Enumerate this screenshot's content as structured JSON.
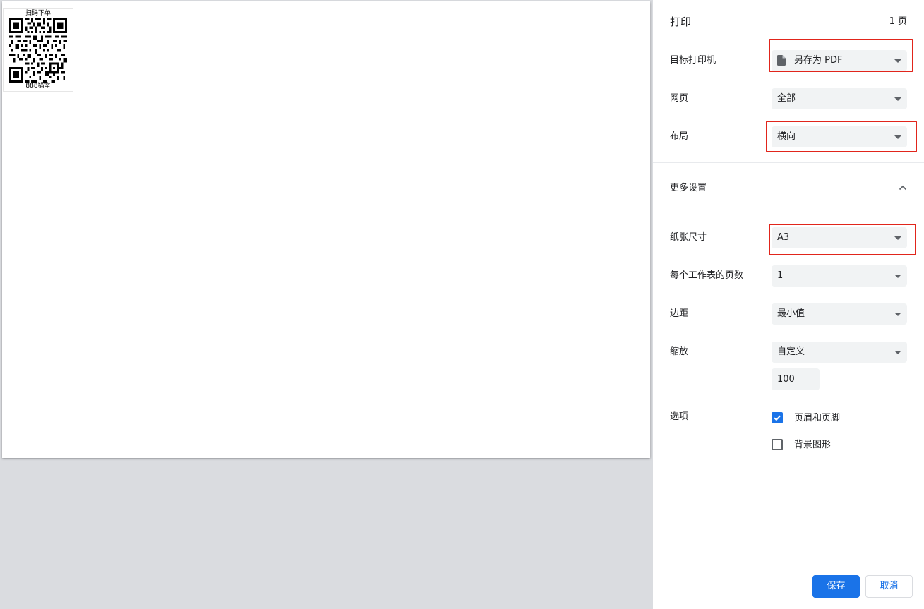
{
  "preview": {
    "label_top_text": "扫码下单",
    "label_bottom_text": "888猫室"
  },
  "header": {
    "title": "打印",
    "page_count": "1 页"
  },
  "settings": {
    "destination": {
      "label": "目标打印机",
      "value": "另存为 PDF",
      "icon": "document-icon"
    },
    "pages": {
      "label": "网页",
      "value": "全部"
    },
    "layout": {
      "label": "布局",
      "value": "横向"
    },
    "more_settings": {
      "label": "更多设置",
      "expanded": true
    },
    "paper_size": {
      "label": "纸张尺寸",
      "value": "A3"
    },
    "pages_per_sheet": {
      "label": "每个工作表的页数",
      "value": "1"
    },
    "margins": {
      "label": "边距",
      "value": "最小值"
    },
    "scale": {
      "label": "缩放",
      "value": "自定义",
      "custom_value": "100"
    },
    "options": {
      "label": "选项",
      "headers_footers": {
        "label": "页眉和页脚",
        "checked": true
      },
      "background_graphics": {
        "label": "背景图形",
        "checked": false
      }
    }
  },
  "buttons": {
    "save": "保存",
    "cancel": "取消"
  },
  "colors": {
    "accent": "#1a73e8",
    "highlight_frame": "#e1251b",
    "preview_background": "#dadce0",
    "select_background": "#f1f3f4"
  }
}
